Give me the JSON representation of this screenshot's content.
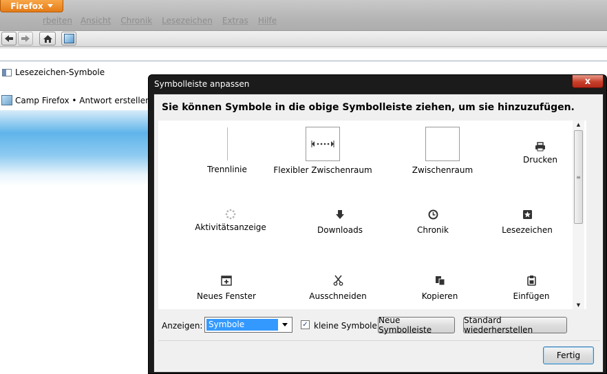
{
  "firefox_button": {
    "label": "Firefox"
  },
  "menubar": [
    "Bearbeiten",
    "Ansicht",
    "Chronik",
    "Lesezeichen",
    "Extras",
    "Hilfe"
  ],
  "menubar_visible": [
    "rbeiten",
    "Ansicht",
    "Chronik",
    "Lesezeichen",
    "Extras",
    "Hilfe"
  ],
  "bookmarks_bar": {
    "label": "Lesezeichen-Symbole"
  },
  "tab": {
    "title": "Camp Firefox • Antwort erstellen"
  },
  "dialog": {
    "title": "Symbolleiste anpassen",
    "close": "x",
    "heading": "Sie können Symbole in die obige Symbolleiste ziehen, um sie hinzuzufügen.",
    "items": [
      {
        "label": "Trennlinie",
        "icon": "separator-icon"
      },
      {
        "label": "Flexibler Zwischenraum",
        "icon": "flexible-space-icon"
      },
      {
        "label": "Zwischenraum",
        "icon": "space-icon"
      },
      {
        "label": "Drucken",
        "icon": "print-icon"
      },
      {
        "label": "Aktivitätsanzeige",
        "icon": "throbber-icon"
      },
      {
        "label": "Downloads",
        "icon": "download-icon"
      },
      {
        "label": "Chronik",
        "icon": "history-icon"
      },
      {
        "label": "Lesezeichen",
        "icon": "bookmark-icon"
      },
      {
        "label": "Neues Fenster",
        "icon": "new-window-icon"
      },
      {
        "label": "Ausschneiden",
        "icon": "cut-icon"
      },
      {
        "label": "Kopieren",
        "icon": "copy-icon"
      },
      {
        "label": "Einfügen",
        "icon": "paste-icon"
      }
    ],
    "show_label": "Anzeigen:",
    "show_value": "Symbole",
    "small_icons": {
      "label": "kleine Symbole",
      "checked": true
    },
    "new_toolbar": "Neue Symbolleiste",
    "restore_default": "Standard wiederherstellen",
    "done": "Fertig"
  }
}
